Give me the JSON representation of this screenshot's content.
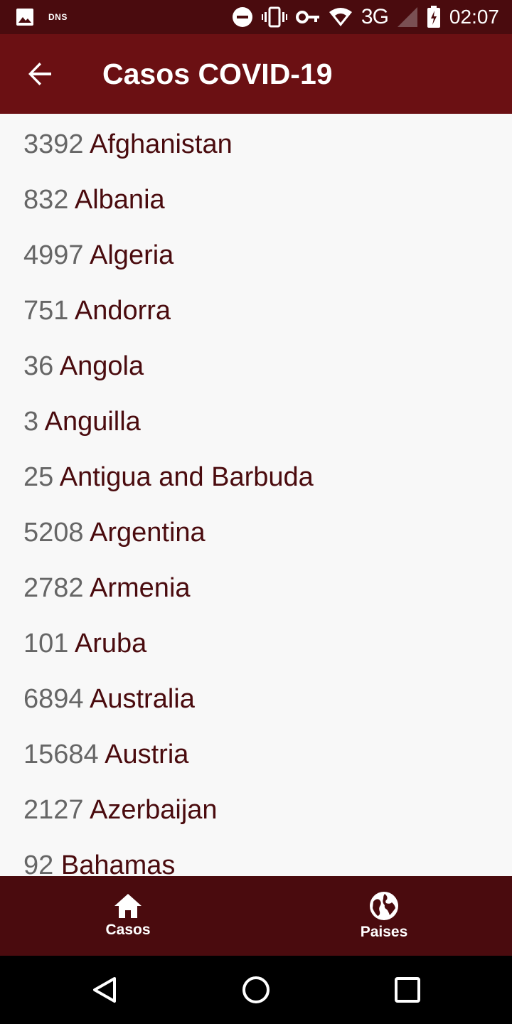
{
  "status_bar": {
    "dns_label": "DNS",
    "network": "3G",
    "time": "02:07",
    "icons": [
      "image-icon",
      "dns-icon",
      "do-not-disturb-icon",
      "vibrate-icon",
      "vpn-key-icon",
      "wifi-icon",
      "signal-icon",
      "battery-charging-icon"
    ]
  },
  "app_bar": {
    "title": "Casos COVID-19",
    "back_icon": "arrow-back-icon",
    "background": "#6b1013"
  },
  "countries": [
    {
      "count": "3392",
      "name": "Afghanistan"
    },
    {
      "count": "832",
      "name": "Albania"
    },
    {
      "count": "4997",
      "name": "Algeria"
    },
    {
      "count": "751",
      "name": "Andorra"
    },
    {
      "count": "36",
      "name": "Angola"
    },
    {
      "count": "3",
      "name": "Anguilla"
    },
    {
      "count": "25",
      "name": "Antigua and Barbuda"
    },
    {
      "count": "5208",
      "name": "Argentina"
    },
    {
      "count": "2782",
      "name": "Armenia"
    },
    {
      "count": "101",
      "name": "Aruba"
    },
    {
      "count": "6894",
      "name": "Australia"
    },
    {
      "count": "15684",
      "name": "Austria"
    },
    {
      "count": "2127",
      "name": "Azerbaijan"
    },
    {
      "count": "92",
      "name": "Bahamas"
    }
  ],
  "bottom_nav": {
    "items": [
      {
        "label": "Casos",
        "icon": "home-icon"
      },
      {
        "label": "Paises",
        "icon": "globe-icon"
      }
    ],
    "background": "#4a0b0e"
  },
  "colors": {
    "count_text": "#666666",
    "country_text": "#4a0b0e",
    "list_background": "#f8f8f8"
  }
}
